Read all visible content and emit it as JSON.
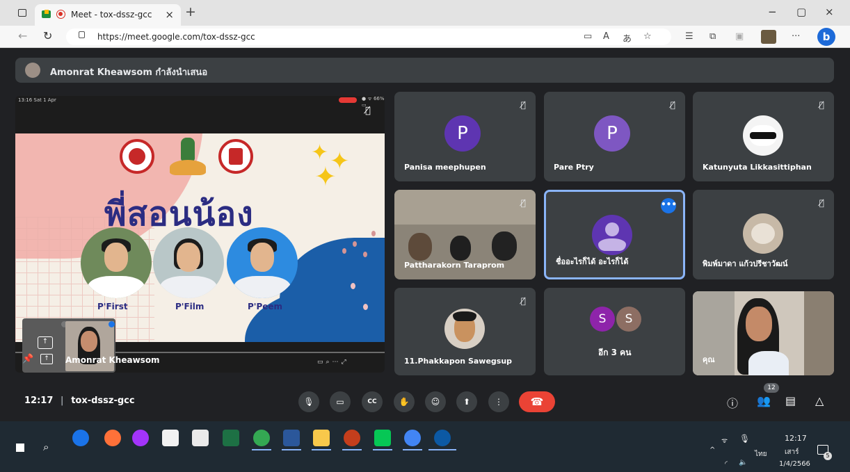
{
  "browser": {
    "tab_title": "Meet - tox-dssz-gcc",
    "tab_close": "×",
    "new_tab": "+",
    "url": "https://meet.google.com/tox-dssz-gcc",
    "minimize": "−",
    "restore": "▢",
    "close": "×",
    "more": "···",
    "bing": "b"
  },
  "presenting": {
    "text": "Amonrat Kheawsom กำลังนำเสนอ"
  },
  "presentation": {
    "status_time": "13:16  Sat 1 Apr",
    "battery": "● ᯤ 66% ▭",
    "headline": "พี่สอนน้อง",
    "people": [
      "P'First",
      "P'Film",
      "P'Peem"
    ],
    "presenter_name": "Amonrat Kheawsom"
  },
  "tiles": [
    {
      "name": "Panisa meephupen",
      "letter": "P",
      "color": "#5e35b1"
    },
    {
      "name": "Pare Ptry",
      "letter": "P",
      "color": "#7e57c2"
    },
    {
      "name": "Katunyuta Likkasittiphan"
    },
    {
      "name": "Pattharakorn Taraprom"
    },
    {
      "name": "ชื่ออะไรก็ได้ อะไรก็ได้"
    },
    {
      "name": "พิมพ์มาดา แก้วปรีชาวัฒน์"
    },
    {
      "name": "11.Phakkapon Sawegsup"
    },
    {
      "others_label": "อีก 3 คน",
      "bubbles": [
        "S",
        "S"
      ]
    },
    {
      "name": "คุณ"
    }
  ],
  "controls": {
    "time": "12:17",
    "meeting_code": "tox-dssz-gcc",
    "people_count": "12"
  },
  "taskbar": {
    "lang": "ไทย",
    "time": "12:17",
    "day": "เสาร์",
    "date": "1/4/2566",
    "notif": "5"
  },
  "colors": {
    "meet_bg": "#202124",
    "tile_bg": "#3c4043",
    "end_call": "#ea4335",
    "accent": "#1a73e8"
  }
}
